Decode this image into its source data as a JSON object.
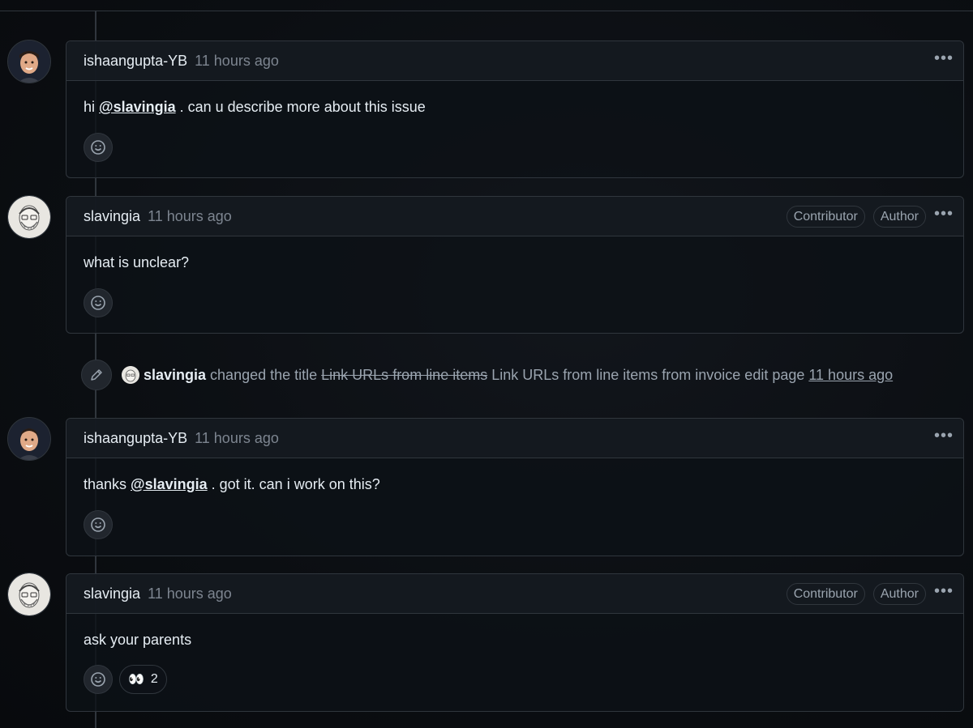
{
  "comments": [
    {
      "author": "ishaangupta-YB",
      "time": "11 hours ago",
      "text_before": "hi ",
      "mention": "@slavingia",
      "text_after": " . can u describe more about this issue",
      "badges": [],
      "reactions": []
    },
    {
      "author": "slavingia",
      "time": "11 hours ago",
      "text": "what is unclear?",
      "badges": [
        "Contributor",
        "Author"
      ],
      "reactions": []
    },
    {
      "author": "ishaangupta-YB",
      "time": "11 hours ago",
      "text_before": "thanks ",
      "mention": "@slavingia",
      "text_after": " . got it. can i work on this?",
      "badges": [],
      "reactions": []
    },
    {
      "author": "slavingia",
      "time": "11 hours ago",
      "text": "ask your parents",
      "badges": [
        "Contributor",
        "Author"
      ],
      "reactions": [
        {
          "emoji": "👀",
          "count": "2"
        }
      ]
    }
  ],
  "event": {
    "actor": "slavingia",
    "action": "changed the title",
    "old_title": "Link URLs from line items",
    "new_title": "Link URLs from line items from invoice edit page",
    "time": "11 hours ago"
  },
  "icons": {
    "more": "kebab-horizontal-icon",
    "reaction": "smiley-icon",
    "edit": "pencil-icon"
  },
  "more_glyph": "•••",
  "colors": {
    "background": "#0d1117",
    "border": "#30363d",
    "muted": "#7d8590"
  }
}
